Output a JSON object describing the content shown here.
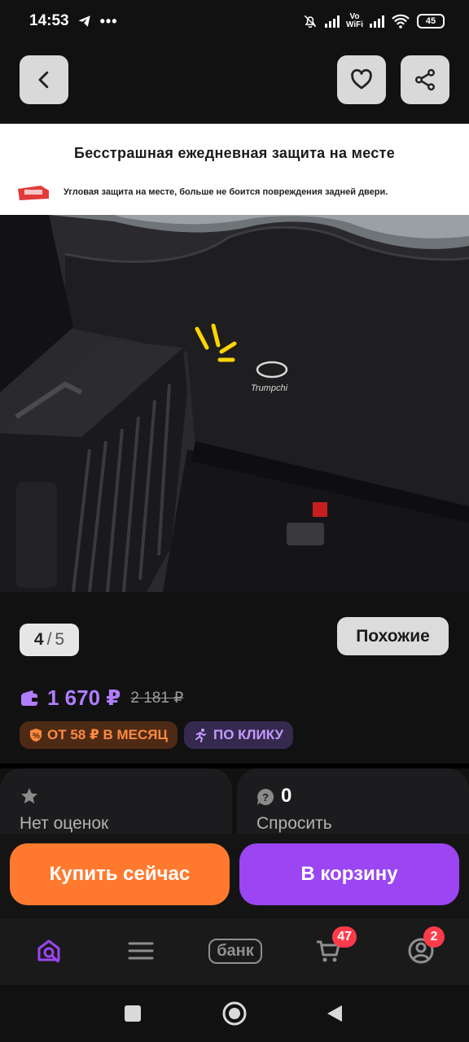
{
  "status_bar": {
    "time": "14:53",
    "network": "Vo WiFi",
    "battery": "45"
  },
  "product": {
    "banner_title": "Бесстрашная ежедневная защита на месте",
    "banner_subtitle": "Угловая защита на месте, больше не боится повреждения задней двери.",
    "brand_logo_text": "Trumpchi",
    "image_index": "4",
    "image_separator": "/",
    "image_total": "5",
    "similar_label": "Похожие",
    "price": "1 670 ₽",
    "old_price": "2 181 ₽",
    "installment_label": "ОТ 58 ₽ В МЕСЯЦ",
    "click_label": "ПО КЛИКУ"
  },
  "rating_card": {
    "label": "Нет оценок"
  },
  "ask_card": {
    "count": "0",
    "label": "Спросить"
  },
  "actions": {
    "buy_now": "Купить сейчас",
    "add_to_cart": "В корзину"
  },
  "bottom_nav": {
    "bank_label": "банк",
    "cart_badge": "47",
    "profile_badge": "2"
  },
  "colors": {
    "accent_purple": "#9b46f2",
    "price_purple": "#b07dff",
    "buy_orange": "#ff7a2f",
    "badge_red": "#ff3b4a"
  },
  "icons": [
    "telegram-icon",
    "more-icon",
    "mute-icon",
    "signal-icon",
    "wifi-icon",
    "battery-icon",
    "back-icon",
    "heart-icon",
    "share-icon",
    "wallet-icon",
    "star-icon",
    "question-icon",
    "home-search-icon",
    "menu-icon",
    "cart-icon",
    "profile-icon"
  ]
}
